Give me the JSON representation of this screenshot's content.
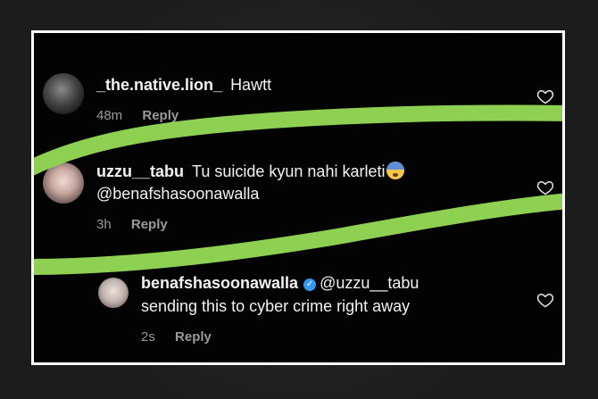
{
  "comments": [
    {
      "username": "_the.native.lion_",
      "text": "Hawtt",
      "time": "48m",
      "reply": "Reply",
      "avatar": "avatar-lion"
    },
    {
      "username": "uzzu__tabu",
      "text": "Tu suicide kyun nahi karleti",
      "mention": "@benafshasoonawalla",
      "time": "3h",
      "reply": "Reply",
      "emoji": "anxious-face-icon",
      "avatar": "avatar-tabu"
    },
    {
      "username": "benafshasoonawalla",
      "verified": true,
      "mention": "@uzzu__tabu",
      "text": "sending this to cyber crime right away",
      "time": "2s",
      "reply": "Reply",
      "avatar": "avatar-benafsha"
    }
  ],
  "colors": {
    "highlight": "#8ed152",
    "background": "#030303",
    "verified": "#3897f0"
  }
}
